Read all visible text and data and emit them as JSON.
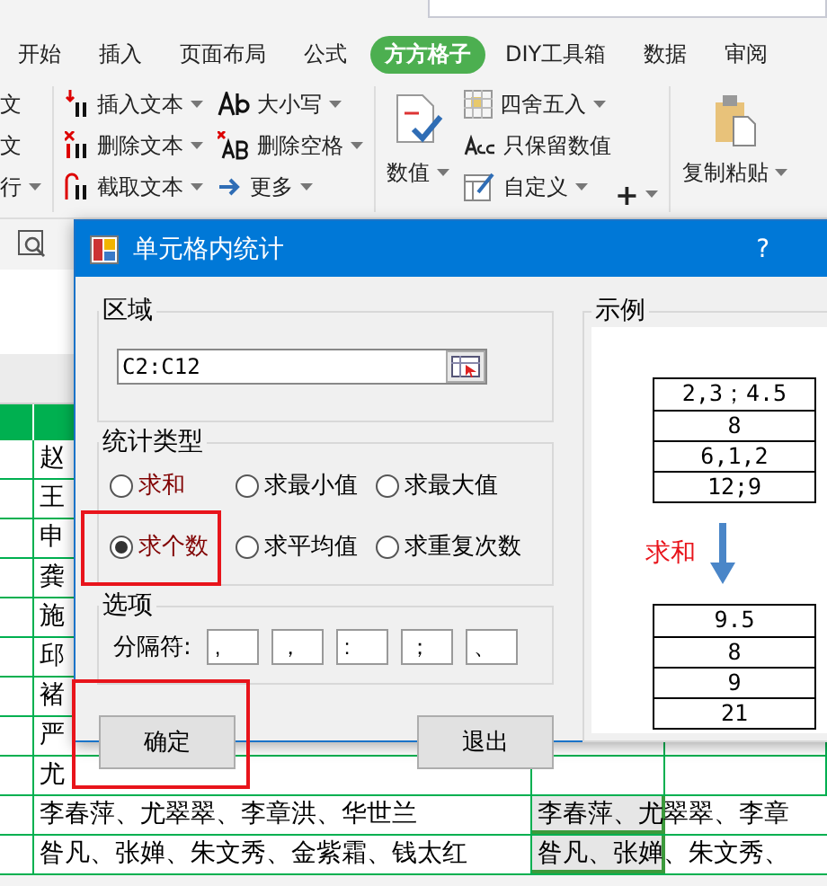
{
  "tabs": [
    {
      "label": "开始",
      "selected": false
    },
    {
      "label": "插入",
      "selected": false
    },
    {
      "label": "页面布局",
      "selected": false
    },
    {
      "label": "公式",
      "selected": false
    },
    {
      "label": "方方格子",
      "selected": true
    },
    {
      "label": "DIY工具箱",
      "selected": false
    },
    {
      "label": "数据",
      "selected": false
    },
    {
      "label": "审阅",
      "selected": false
    }
  ],
  "ribbon": {
    "cut_items": [
      {
        "label": "文",
        "dropdown": false
      },
      {
        "label": "文",
        "dropdown": false
      },
      {
        "label": "行",
        "dropdown": true
      }
    ],
    "text_tools": [
      {
        "label": "插入文本",
        "kind": "insert"
      },
      {
        "label": "删除文本",
        "kind": "delete"
      },
      {
        "label": "截取文本",
        "kind": "cut"
      }
    ],
    "case_tools": [
      {
        "label": "大小写",
        "kind": "case"
      },
      {
        "label": "删除空格",
        "kind": "space"
      },
      {
        "label": "更多",
        "kind": "more"
      }
    ],
    "number_button": {
      "label": "数值"
    },
    "number_tools": [
      {
        "label": "四舍五入",
        "kind": "round",
        "dropdown": true
      },
      {
        "label": "只保留数值",
        "kind": "keep",
        "dropdown": false
      },
      {
        "label": "自定义",
        "kind": "custom",
        "dropdown": true
      }
    ],
    "plus_button": {
      "label": "+"
    },
    "paste_button": {
      "label": "复制粘贴"
    }
  },
  "sheet": {
    "rows": [
      {
        "col_b": "赵"
      },
      {
        "col_b": "王"
      },
      {
        "col_b": "申"
      },
      {
        "col_b": "龚"
      },
      {
        "col_b": "施"
      },
      {
        "col_b": "邱"
      },
      {
        "col_b": "褚"
      },
      {
        "col_b": "严"
      },
      {
        "col_b": "尤"
      },
      {
        "col_b": "李春萍、尤翠翠、李章洪、华世兰",
        "col_c": "李春萍、尤翠翠、李章",
        "selected": true
      },
      {
        "col_b": "昝凡、张婵、朱文秀、金紫霜、钱太红",
        "col_c": "昝凡、张婵、朱文秀、",
        "selected": true
      }
    ]
  },
  "dialog": {
    "title": "单元格内统计",
    "help": "?",
    "region": {
      "label": "区域",
      "value": "C2:C12"
    },
    "type_group": {
      "label": "统计类型",
      "options": [
        {
          "label": "求和",
          "selected": false,
          "highlighted": false,
          "color": "#800000"
        },
        {
          "label": "求最小值",
          "selected": false,
          "highlighted": false,
          "color": "#000000"
        },
        {
          "label": "求最大值",
          "selected": false,
          "highlighted": false,
          "color": "#000000"
        },
        {
          "label": "求个数",
          "selected": true,
          "highlighted": true,
          "color": "#800000"
        },
        {
          "label": "求平均值",
          "selected": false,
          "highlighted": false,
          "color": "#000000"
        },
        {
          "label": "求重复次数",
          "selected": false,
          "highlighted": false,
          "color": "#000000"
        }
      ]
    },
    "options": {
      "label": "选项",
      "separator_label": "分隔符:",
      "separators": [
        ",",
        "，",
        ":",
        "；",
        "、"
      ]
    },
    "buttons": [
      {
        "label": "确定",
        "highlighted": true
      },
      {
        "label": "退出",
        "highlighted": false
      }
    ],
    "example": {
      "label": "示例",
      "input": [
        "2,3；4.5",
        "8",
        "6,1,2",
        "12;9"
      ],
      "operation": "求和",
      "output": [
        "9.5",
        "8",
        "9",
        "21"
      ]
    }
  }
}
